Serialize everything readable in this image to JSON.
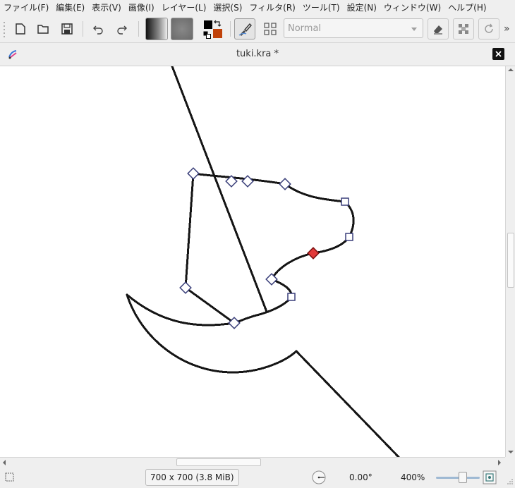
{
  "menubar": {
    "items": [
      "ファイル(F)",
      "編集(E)",
      "表示(V)",
      "画像(I)",
      "レイヤー(L)",
      "選択(S)",
      "フィルタ(R)",
      "ツール(T)",
      "設定(N)",
      "ウィンドウ(W)",
      "ヘルプ(H)"
    ]
  },
  "toolbar": {
    "blend_mode": "Normal",
    "overflow": "»",
    "foreground_color": "#000000",
    "background_color": "#c0420a"
  },
  "document": {
    "title": "tuki.kra *"
  },
  "statusbar": {
    "image_size": "700 x 700 (3.8 MiB)",
    "rotation": "0.00°",
    "zoom": "400%"
  },
  "colors": {
    "selected_node": "#e23a3a",
    "node_outline": "#3a3f7a"
  }
}
